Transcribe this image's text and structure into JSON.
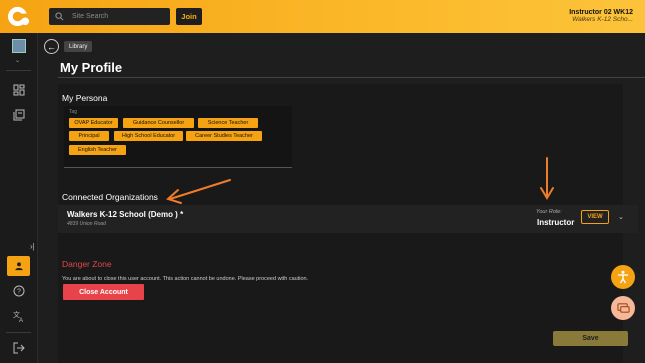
{
  "topbar": {
    "search_placeholder": "Site Search",
    "join_label": "Join",
    "user_name": "Instructor 02 WK12",
    "user_school": "Walkers K-12 Scho..."
  },
  "breadcrumb": "Library",
  "page_title": "My Profile",
  "persona": {
    "title": "My Persona",
    "tag_label": "Tag",
    "chips": [
      "OVAP Educator",
      "Guidance Counsellor",
      "Science Teacher",
      "Principal",
      "High School Educator",
      "Career Studies Teacher",
      "English Teacher"
    ]
  },
  "organizations": {
    "title": "Connected Organizations",
    "items": [
      {
        "name": "Walkers K-12 School (Demo ) *",
        "address": "4839 Union Road",
        "role_label": "Your Role:",
        "role": "Instructor",
        "view_label": "VIEW"
      }
    ]
  },
  "danger": {
    "title": "Danger Zone",
    "text": "You are about to close this user account. This action cannot be undone. Please proceed with caution.",
    "close_label": "Close Account"
  },
  "save_label": "Save",
  "colors": {
    "accent": "#f5a313",
    "danger": "#e04848",
    "background": "#1e1e1e"
  }
}
